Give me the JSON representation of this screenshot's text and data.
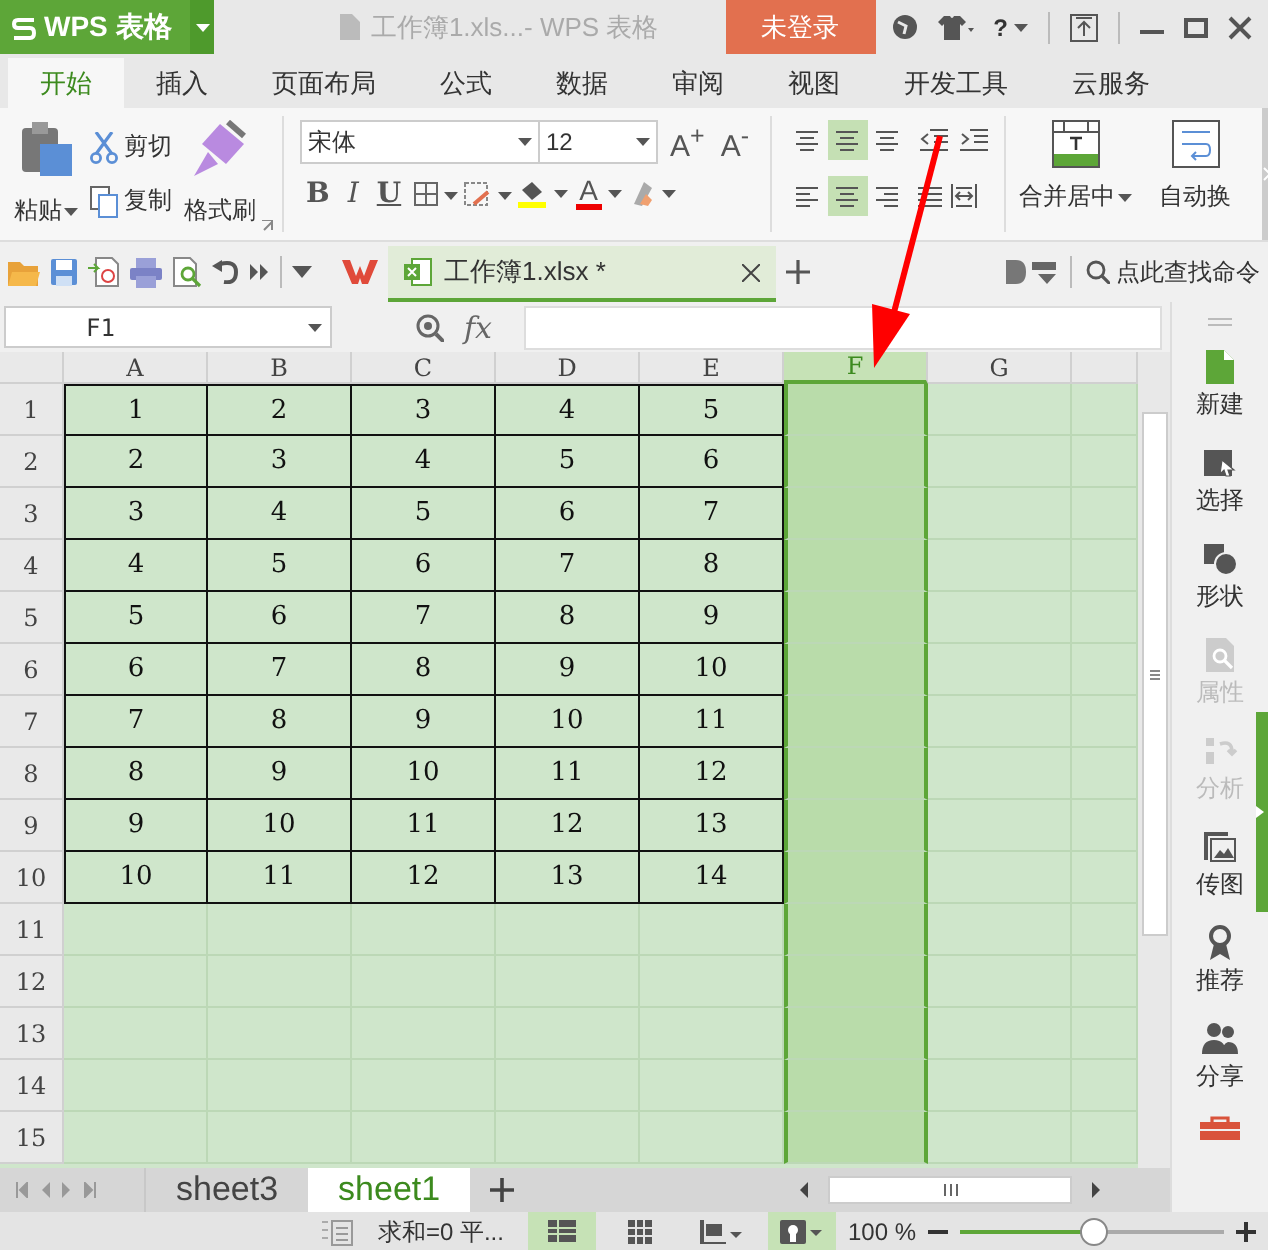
{
  "title_bar": {
    "logo": "WPS 表格",
    "document_title": "工作簿1.xls...- WPS 表格",
    "login_button": "未登录",
    "help": "?"
  },
  "ribbon_tabs": [
    {
      "label": "开始",
      "selected": true
    },
    {
      "label": "插入",
      "selected": false
    },
    {
      "label": "页面布局",
      "selected": false
    },
    {
      "label": "公式",
      "selected": false
    },
    {
      "label": "数据",
      "selected": false
    },
    {
      "label": "审阅",
      "selected": false
    },
    {
      "label": "视图",
      "selected": false
    },
    {
      "label": "开发工具",
      "selected": false
    },
    {
      "label": "云服务",
      "selected": false
    }
  ],
  "ribbon": {
    "paste": "粘贴",
    "cut": "剪切",
    "copy": "复制",
    "format_painter": "格式刷",
    "font_name": "宋体",
    "font_size": "12",
    "font_grow": "A$^{+}$",
    "font_shrink": "A$^{-}$",
    "style_buttons": [
      "B",
      "I",
      "U"
    ],
    "font_color": "A",
    "vertical_align": [
      {
        "selected": false
      },
      {
        "selected": true
      },
      {
        "selected": false
      }
    ],
    "horizontal_align": [
      {
        "selected": false
      },
      {
        "selected": true
      },
      {
        "selected": false
      }
    ],
    "merge_center": "合并居中",
    "wrap_text": "自动换"
  },
  "document_tabs": [
    {
      "label": "工作簿1.xlsx *",
      "selected": true
    }
  ],
  "command_search": {
    "placeholder": "点此查找命令"
  },
  "formula_bar": {
    "name_box": "F1",
    "fx": "fx"
  },
  "sheet": {
    "columns": [
      {
        "label": "A",
        "selected": false
      },
      {
        "label": "B",
        "selected": false
      },
      {
        "label": "C",
        "selected": false
      },
      {
        "label": "D",
        "selected": false
      },
      {
        "label": "E",
        "selected": false
      },
      {
        "label": "F",
        "selected": true
      },
      {
        "label": "G",
        "selected": false
      }
    ],
    "rows": [
      {
        "label": "1",
        "cells": [
          "1",
          "2",
          "3",
          "4",
          "5"
        ]
      },
      {
        "label": "2",
        "cells": [
          "2",
          "3",
          "4",
          "5",
          "6"
        ]
      },
      {
        "label": "3",
        "cells": [
          "3",
          "4",
          "5",
          "6",
          "7"
        ]
      },
      {
        "label": "4",
        "cells": [
          "4",
          "5",
          "6",
          "7",
          "8"
        ]
      },
      {
        "label": "5",
        "cells": [
          "5",
          "6",
          "7",
          "8",
          "9"
        ]
      },
      {
        "label": "6",
        "cells": [
          "6",
          "7",
          "8",
          "9",
          "10"
        ]
      },
      {
        "label": "7",
        "cells": [
          "7",
          "8",
          "9",
          "10",
          "11"
        ]
      },
      {
        "label": "8",
        "cells": [
          "8",
          "9",
          "10",
          "11",
          "12"
        ]
      },
      {
        "label": "9",
        "cells": [
          "9",
          "10",
          "11",
          "12",
          "13"
        ]
      },
      {
        "label": "10",
        "cells": [
          "10",
          "11",
          "12",
          "13",
          "14"
        ]
      },
      {
        "label": "11",
        "cells": []
      },
      {
        "label": "12",
        "cells": []
      },
      {
        "label": "13",
        "cells": []
      },
      {
        "label": "14",
        "cells": []
      },
      {
        "label": "15",
        "cells": []
      }
    ]
  },
  "sidebar": {
    "items": [
      {
        "label": "新建",
        "kind": "new",
        "disabled": false
      },
      {
        "label": "选择",
        "kind": "select",
        "disabled": false
      },
      {
        "label": "形状",
        "kind": "shape",
        "disabled": false
      },
      {
        "label": "属性",
        "kind": "properties",
        "disabled": true
      },
      {
        "label": "分析",
        "kind": "analyze",
        "disabled": true
      },
      {
        "label": "传图",
        "kind": "image",
        "disabled": false
      },
      {
        "label": "推荐",
        "kind": "recommend",
        "disabled": false
      },
      {
        "label": "分享",
        "kind": "share",
        "disabled": false
      }
    ]
  },
  "sheet_tabs": [
    {
      "label": "sheet3",
      "selected": false
    },
    {
      "label": "sheet1",
      "selected": true
    }
  ],
  "status_bar": {
    "summary": "求和=0  平...",
    "view_modes": [
      {
        "selected": true
      },
      {
        "selected": false
      },
      {
        "selected": false
      }
    ],
    "eye_care_on": true,
    "zoom": "100 %",
    "zoom_slider": {
      "level": 0.5
    }
  }
}
